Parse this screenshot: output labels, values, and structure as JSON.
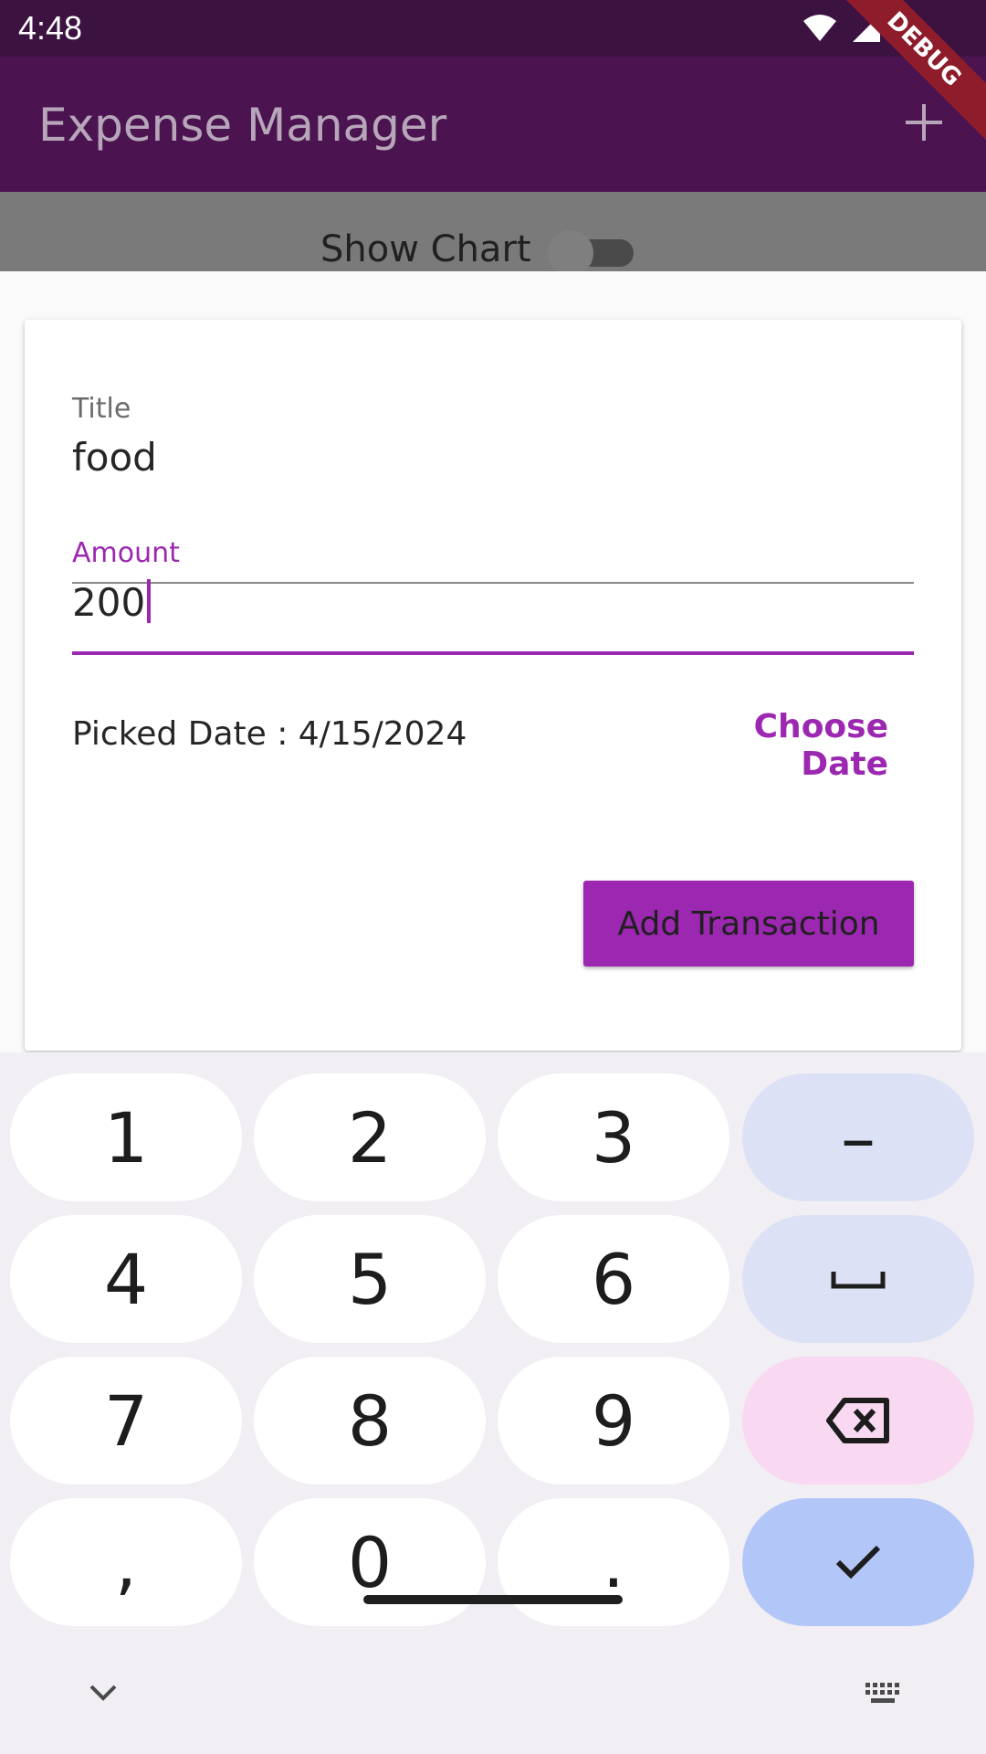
{
  "status_bar": {
    "time": "4:48",
    "debug_label": "DEBUG"
  },
  "app_bar": {
    "title": "Expense Manager"
  },
  "chart_toggle": {
    "label": "Show Chart",
    "on": false
  },
  "form": {
    "title_label": "Title",
    "title_value": "food",
    "amount_label": "Amount",
    "amount_value": "200",
    "picked_date": "Picked Date : 4/15/2024",
    "choose_date": "Choose Date",
    "submit": "Add Transaction"
  },
  "keyboard": {
    "keys": [
      "1",
      "2",
      "3",
      "–",
      "4",
      "5",
      "6",
      "␣",
      "7",
      "8",
      "9",
      "⌫",
      ",",
      "0",
      ".",
      "✓"
    ]
  },
  "colors": {
    "accent": "#9c27b0",
    "app_bar": "#4b1450",
    "status_bar": "#3b1240"
  }
}
